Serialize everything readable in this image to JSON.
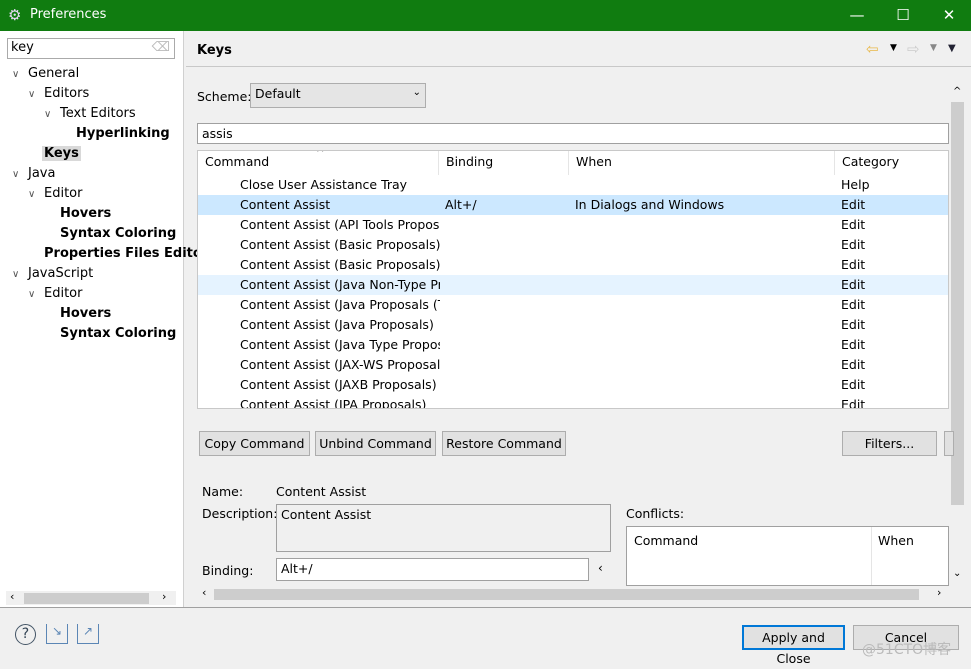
{
  "window": {
    "title": "Preferences",
    "minimize": "—",
    "maximize": "☐",
    "close": "✕"
  },
  "sidebar": {
    "filter_value": "key",
    "tree": [
      {
        "label": "General",
        "bold": false,
        "expanded": true
      },
      {
        "label": "Editors",
        "bold": false,
        "expanded": true
      },
      {
        "label": "Text Editors",
        "bold": false,
        "expanded": true
      },
      {
        "label": "Hyperlinking",
        "bold": true
      },
      {
        "label": "Keys",
        "bold": true,
        "selected": true
      },
      {
        "label": "Java",
        "bold": false,
        "expanded": true
      },
      {
        "label": "Editor",
        "bold": false,
        "expanded": true
      },
      {
        "label": "Hovers",
        "bold": true
      },
      {
        "label": "Syntax Coloring",
        "bold": true
      },
      {
        "label": "Properties Files Edito",
        "bold": true
      },
      {
        "label": "JavaScript",
        "bold": false,
        "expanded": true
      },
      {
        "label": "Editor",
        "bold": false,
        "expanded": true
      },
      {
        "label": "Hovers",
        "bold": true
      },
      {
        "label": "Syntax Coloring",
        "bold": true
      }
    ]
  },
  "page": {
    "title": "Keys",
    "scheme_label": "Scheme:",
    "scheme_value": "Default",
    "search_value": "assis",
    "columns": [
      "Command",
      "Binding",
      "When",
      "Category"
    ],
    "rows": [
      [
        "Close User Assistance Tray",
        "",
        "",
        "Help"
      ],
      [
        "Content Assist",
        "Alt+/",
        "In Dialogs and Windows",
        "Edit"
      ],
      [
        "Content Assist (API Tools Proposal",
        "",
        "",
        "Edit"
      ],
      [
        "Content Assist (Basic Proposals)",
        "",
        "",
        "Edit"
      ],
      [
        "Content Assist (Basic Proposals)",
        "",
        "",
        "Edit"
      ],
      [
        "Content Assist (Java Non-Type Pro",
        "",
        "",
        "Edit"
      ],
      [
        "Content Assist (Java Proposals (Ta",
        "",
        "",
        "Edit"
      ],
      [
        "Content Assist (Java Proposals)",
        "",
        "",
        "Edit"
      ],
      [
        "Content Assist (Java Type Proposa",
        "",
        "",
        "Edit"
      ],
      [
        "Content Assist (JAX-WS Proposals)",
        "",
        "",
        "Edit"
      ],
      [
        "Content Assist (JAXB Proposals)",
        "",
        "",
        "Edit"
      ],
      [
        "Content Assist (JPA Proposals)",
        "",
        "",
        "Edit"
      ]
    ],
    "buttons": {
      "copy": "Copy Command",
      "unbind": "Unbind Command",
      "restore": "Restore Command",
      "filters": "Filters..."
    },
    "details": {
      "name_label": "Name:",
      "name_value": "Content Assist",
      "description_label": "Description:",
      "description_value": "Content Assist",
      "binding_label": "Binding:",
      "binding_value": "Alt+/",
      "conflicts_label": "Conflicts:",
      "conflict_columns": [
        "Command",
        "When"
      ]
    }
  },
  "footer": {
    "apply_close": "Apply and Close",
    "cancel": "Cancel",
    "watermark": "@51CTO博客"
  },
  "colors": {
    "titlebar": "#107c10",
    "selection": "#cce8ff"
  }
}
